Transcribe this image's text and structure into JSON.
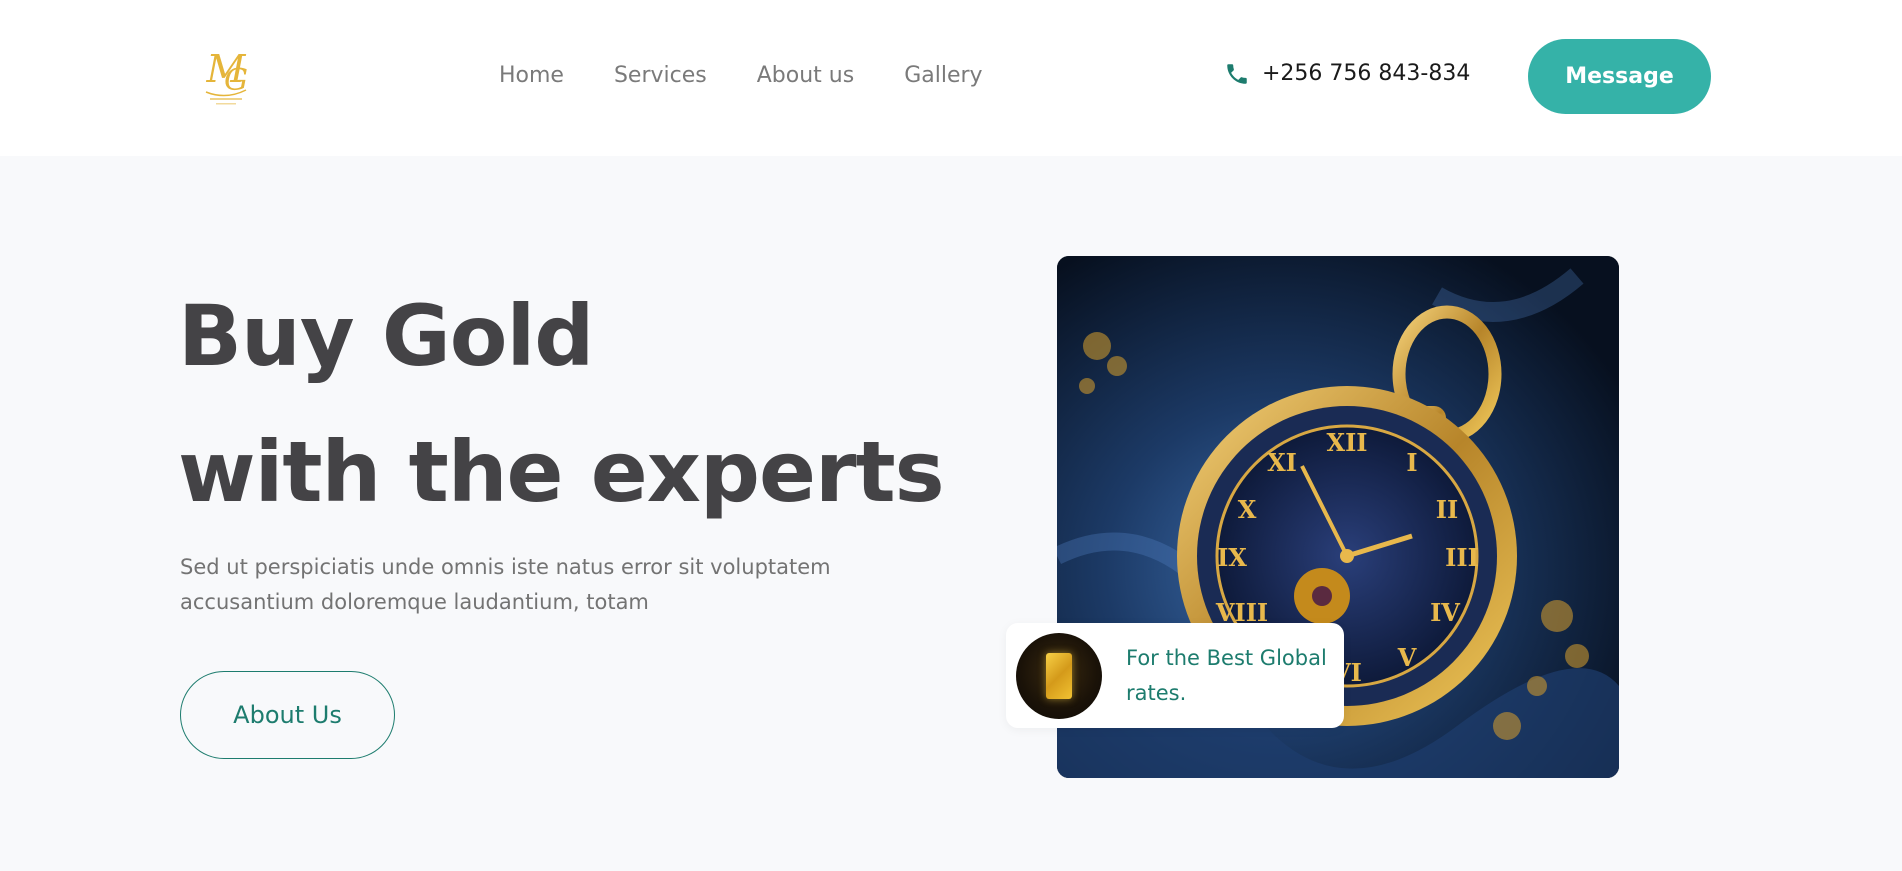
{
  "header": {
    "logo_text": "MG",
    "nav": [
      {
        "label": "Home"
      },
      {
        "label": "Services"
      },
      {
        "label": "About us"
      },
      {
        "label": "Gallery"
      }
    ],
    "phone": "+256 756 843-834",
    "message_label": "Message"
  },
  "hero": {
    "title_line1": "Buy Gold",
    "title_line2": "with the experts",
    "text": "Sed ut perspiciatis unde omnis iste natus error sit voluptatem accusantium doloremque laudantium, totam",
    "about_label": "About Us",
    "rates_text": "For the Best Global rates."
  },
  "colors": {
    "accent": "#35b2a8",
    "accent_dark": "#1d7c6e",
    "gold": "#e5b53a",
    "title": "#444346",
    "background": "#f8f9fb"
  },
  "icons": {
    "phone": "phone-icon",
    "logo": "mg-logo-icon"
  }
}
